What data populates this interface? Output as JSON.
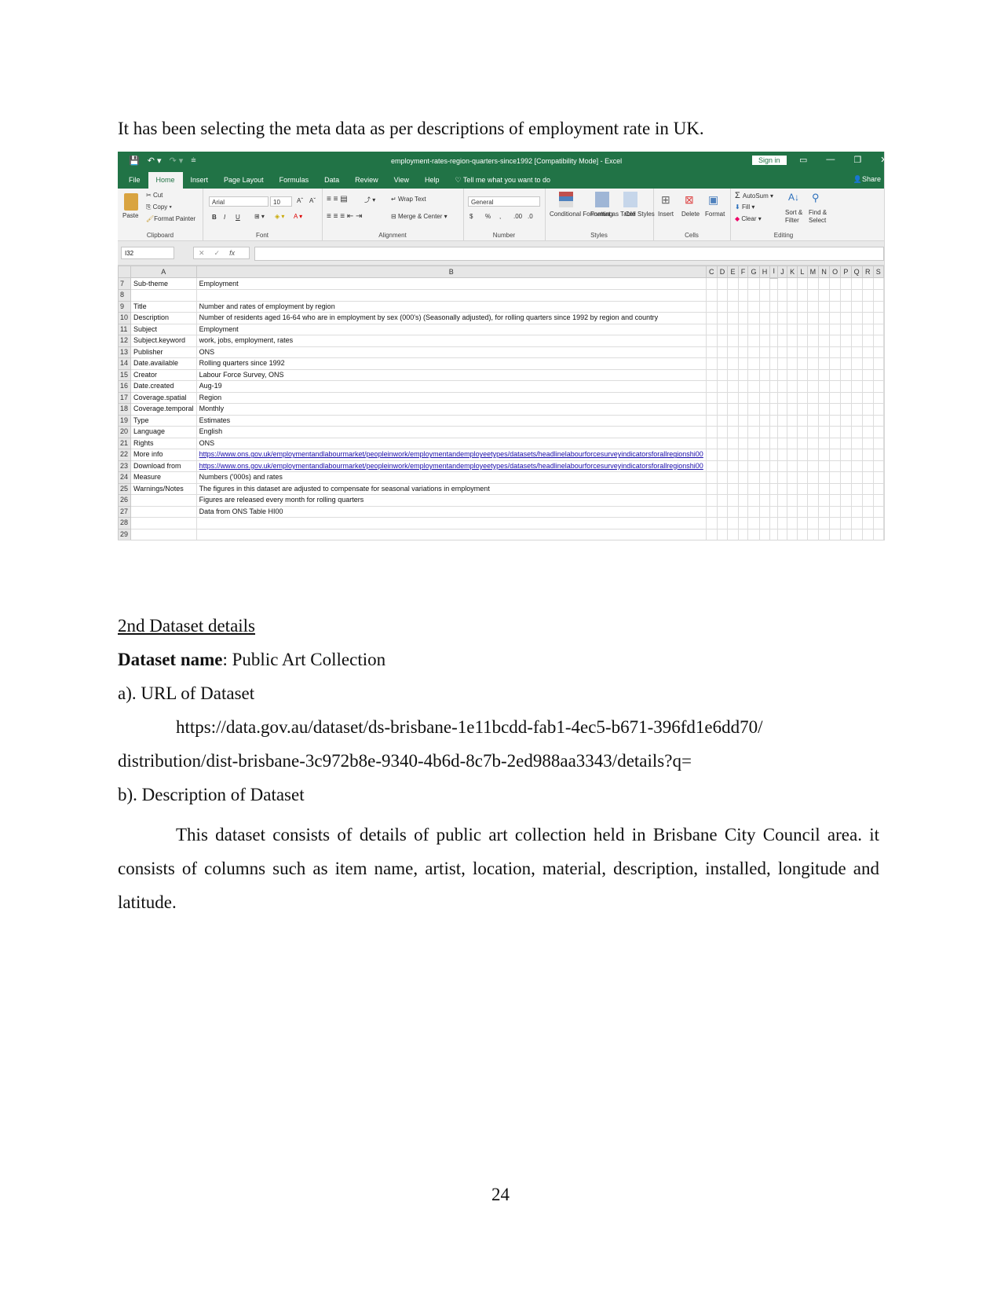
{
  "intro_text": "It has been selecting the meta data as per descriptions of employment rate in UK.",
  "excel": {
    "window_title": "employment-rates-region-quarters-since1992  [Compatibility Mode]  -  Excel",
    "sign_in": "Sign in",
    "share": "Share",
    "icons": {
      "save": "💾",
      "undo": "↶ ▾",
      "redo": "↷ ▾",
      "customize": "⩧",
      "ribbon_display": "▭",
      "minimize": "—",
      "restore": "❐",
      "close": "✕"
    },
    "tabs": [
      "File",
      "Home",
      "Insert",
      "Page Layout",
      "Formulas",
      "Data",
      "Review",
      "View",
      "Help"
    ],
    "active_tab": "Home",
    "tell_me": "Tell me what you want to do",
    "ribbon": {
      "clipboard": {
        "label": "Clipboard",
        "paste": "Paste",
        "cut": "Cut",
        "copy": "Copy",
        "format_painter": "Format Painter"
      },
      "font": {
        "label": "Font",
        "font_name": "Arial",
        "font_size": "10",
        "bold": "B",
        "italic": "I",
        "underline": "U",
        "grow": "Aˆ",
        "shrink": "Aˇ"
      },
      "alignment": {
        "label": "Alignment",
        "wrap_text": "Wrap Text",
        "merge_center": "Merge & Center"
      },
      "number": {
        "label": "Number",
        "format": "General",
        "currency": "$",
        "percent": "%",
        "comma": ",",
        "inc_decimal": ".00",
        "dec_decimal": ".0"
      },
      "styles": {
        "label": "Styles",
        "conditional": "Conditional Formatting",
        "format_table": "Format as Table",
        "cell_styles": "Cell Styles"
      },
      "cells": {
        "label": "Cells",
        "insert": "Insert",
        "delete": "Delete",
        "format": "Format"
      },
      "editing": {
        "label": "Editing",
        "autosum": "AutoSum",
        "fill": "Fill",
        "clear": "Clear",
        "sort_filter": "Sort & Filter",
        "find_select": "Find & Select"
      }
    },
    "name_box": "I32",
    "formula_value": "",
    "columns": [
      "A",
      "B",
      "C",
      "D",
      "E",
      "F",
      "G",
      "H",
      "I",
      "J",
      "K",
      "L",
      "M",
      "N",
      "O",
      "P",
      "Q",
      "R",
      "S"
    ],
    "selected_column": "I",
    "rows": [
      {
        "n": "7",
        "a": "Sub-theme",
        "b": "Employment"
      },
      {
        "n": "8",
        "a": "",
        "b": ""
      },
      {
        "n": "9",
        "a": "Title",
        "b": "Number and rates of employment by region"
      },
      {
        "n": "10",
        "a": "Description",
        "b": "Number of residents aged 16-64 who are in employment by sex (000's) (Seasonally adjusted), for rolling quarters since 1992 by region and country"
      },
      {
        "n": "11",
        "a": "Subject",
        "b": "Employment"
      },
      {
        "n": "12",
        "a": "Subject.keyword",
        "b": "work, jobs, employment, rates"
      },
      {
        "n": "13",
        "a": "Publisher",
        "b": "ONS"
      },
      {
        "n": "14",
        "a": "Date.available",
        "b": "Rolling quarters since 1992"
      },
      {
        "n": "15",
        "a": "Creator",
        "b": "Labour Force Survey, ONS"
      },
      {
        "n": "16",
        "a": "Date.created",
        "b": "Aug-19"
      },
      {
        "n": "17",
        "a": "Coverage.spatial",
        "b": "Region"
      },
      {
        "n": "18",
        "a": "Coverage.temporal",
        "b": "Monthly"
      },
      {
        "n": "19",
        "a": "Type",
        "b": "Estimates"
      },
      {
        "n": "20",
        "a": "Language",
        "b": "English"
      },
      {
        "n": "21",
        "a": "Rights",
        "b": "ONS"
      },
      {
        "n": "22",
        "a": "More info",
        "b": "https://www.ons.gov.uk/employmentandlabourmarket/peopleinwork/employmentandemployeetypes/datasets/headlinelabourforcesurveyindicatorsforallregionshi00",
        "link": true
      },
      {
        "n": "23",
        "a": "Download from",
        "b": "https://www.ons.gov.uk/employmentandlabourmarket/peopleinwork/employmentandemployeetypes/datasets/headlinelabourforcesurveyindicatorsforallregionshi00",
        "link": true
      },
      {
        "n": "24",
        "a": "Measure",
        "b": "Numbers ('000s) and rates"
      },
      {
        "n": "25",
        "a": "Warnings/Notes",
        "b": "The figures in this dataset are adjusted to compensate for seasonal variations in employment"
      },
      {
        "n": "26",
        "a": "",
        "b": "Figures are released every month for rolling quarters"
      },
      {
        "n": "27",
        "a": "",
        "b": "Data from ONS Table HI00"
      },
      {
        "n": "28",
        "a": "",
        "b": ""
      },
      {
        "n": "29",
        "a": "",
        "b": ""
      }
    ]
  },
  "section2": {
    "heading": "2nd Dataset details",
    "name_label": "Dataset name",
    "name_value": ": Public Art Collection",
    "url_heading": "a). URL of Dataset",
    "url_line1": "https://data.gov.au/dataset/ds-brisbane-1e11bcdd-fab1-4ec5-b671-396fd1e6dd70/",
    "url_line2": "distribution/dist-brisbane-3c972b8e-9340-4b6d-8c7b-2ed988aa3343/details?q=",
    "desc_heading": "b). Description of Dataset",
    "description": "This dataset consists of details of public art collection held in Brisbane City Council area. it consists of columns such as item name, artist, location, material, description, installed, longitude and latitude."
  },
  "page_number": "24"
}
